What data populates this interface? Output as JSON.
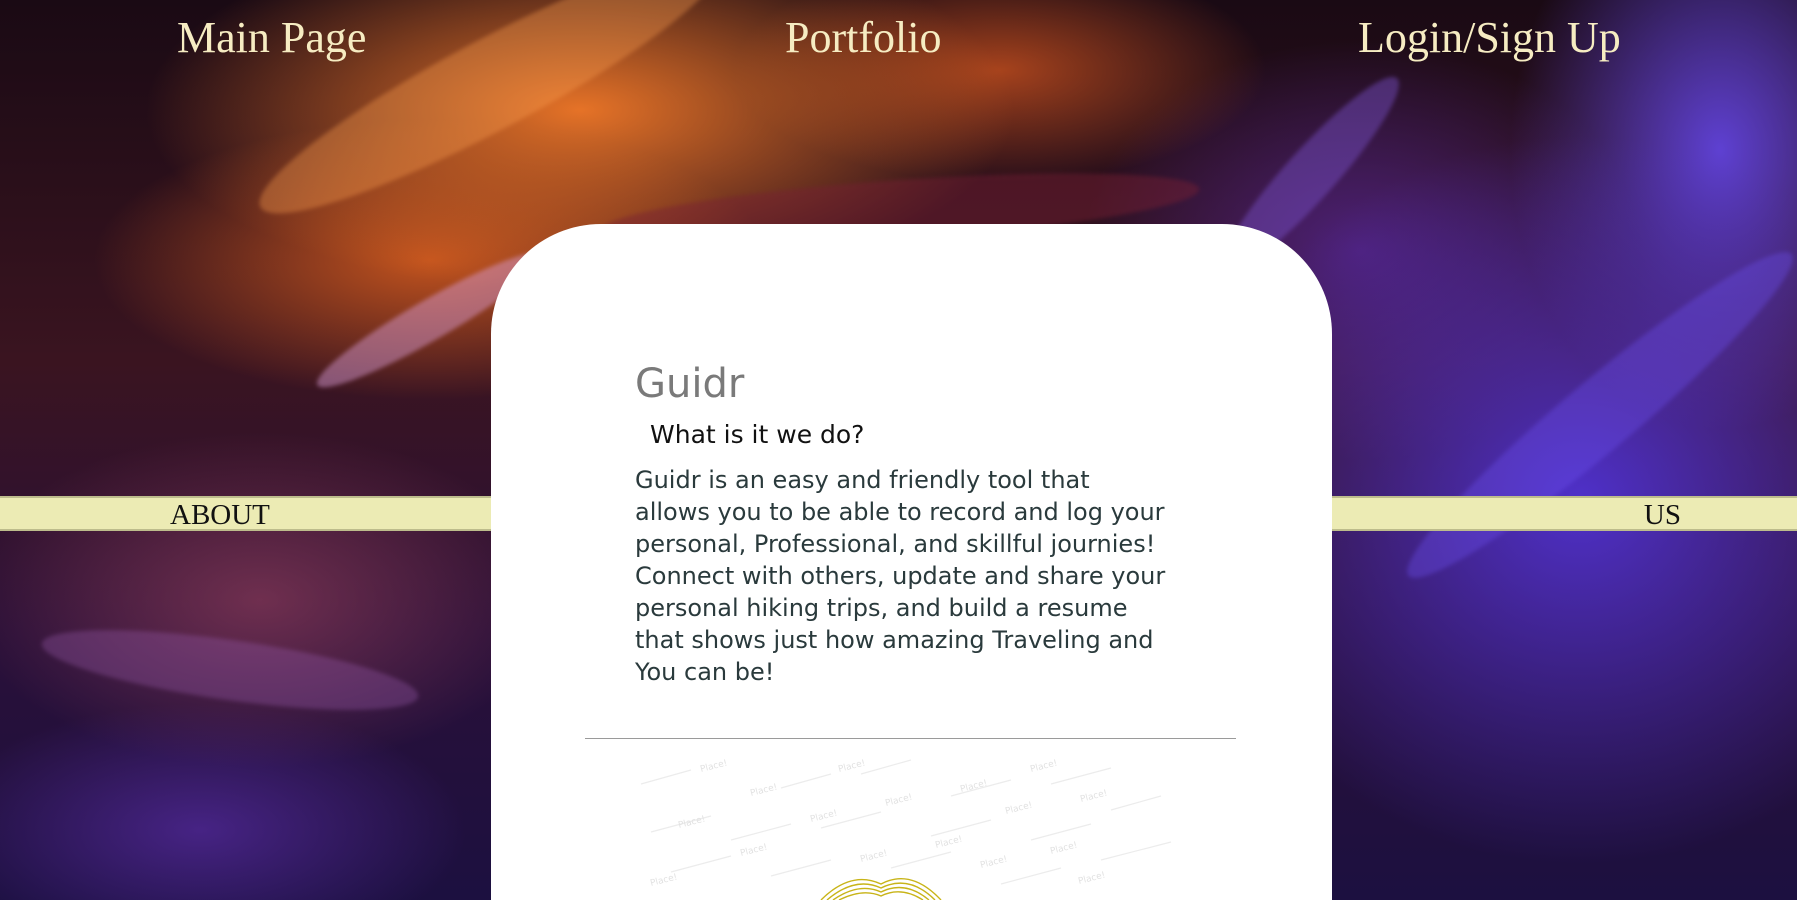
{
  "nav": {
    "main_page": "Main Page",
    "portfolio": "Portfolio",
    "login_signup": "Login/Sign Up"
  },
  "strips": {
    "left_label": "ABOUT",
    "right_label": "US"
  },
  "card": {
    "title": "Guidr",
    "subtitle": "What is it we do?",
    "body": "Guidr is an easy and friendly tool that allows you to be able to record and log your personal, Professional, and skillful journies! Connect with others, update and share your personal hiking trips, and build a resume that shows just how amazing Traveling and You can be!"
  },
  "illustration": {
    "icon": "map-places-icon",
    "pin_label": "Place!",
    "accent_color": "#c8b418"
  },
  "colors": {
    "nav_text": "#f6ecc2",
    "strip_bg": "#ecebb4",
    "card_bg": "#ffffff",
    "title_text": "#7a7a7a",
    "body_text": "#2a3a3c"
  }
}
